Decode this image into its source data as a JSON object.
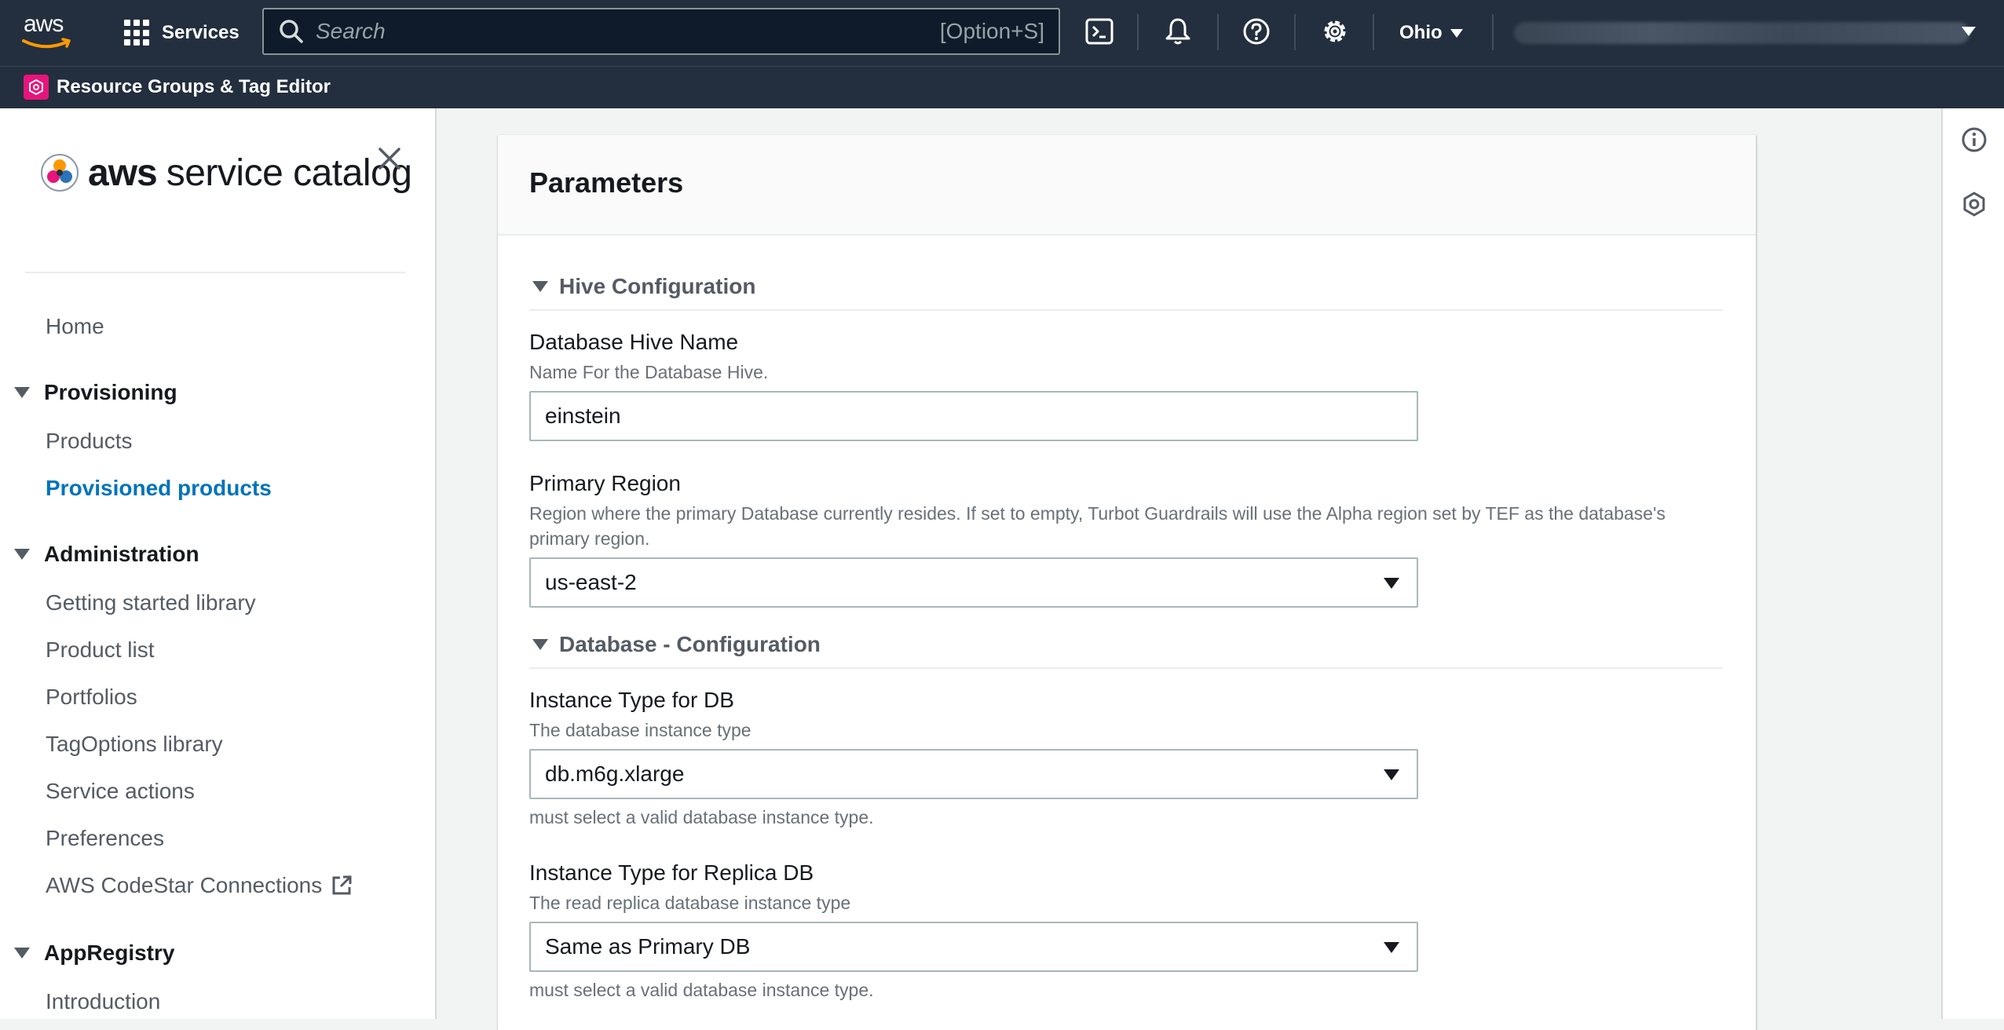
{
  "topnav": {
    "logo_text": "aws",
    "services_label": "Services",
    "search_placeholder": "Search",
    "search_shortcut": "[Option+S]",
    "region_label": "Ohio"
  },
  "subnav": {
    "resource_groups_label": "Resource Groups & Tag Editor"
  },
  "sidebar": {
    "brand_aws": "aws",
    "brand_name": "service catalog",
    "home": "Home",
    "sections": [
      {
        "title": "Provisioning",
        "items": [
          "Products",
          "Provisioned products"
        ]
      },
      {
        "title": "Administration",
        "items": [
          "Getting started library",
          "Product list",
          "Portfolios",
          "TagOptions library",
          "Service actions",
          "Preferences",
          "AWS CodeStar Connections"
        ]
      },
      {
        "title": "AppRegistry",
        "items": [
          "Introduction"
        ]
      }
    ],
    "active_item": "Provisioned products"
  },
  "panel": {
    "title": "Parameters",
    "groups": [
      {
        "label": "Hive Configuration"
      },
      {
        "label": "Database - Configuration"
      }
    ],
    "fields": [
      {
        "label": "Database Hive Name",
        "description": "Name For the Database Hive.",
        "value": "einstein",
        "type": "text"
      },
      {
        "label": "Primary Region",
        "description": "Region where the primary Database currently resides. If set to empty, Turbot Guardrails will use the Alpha region set by TEF as the database's primary region.",
        "value": "us-east-2",
        "type": "select"
      },
      {
        "label": "Instance Type for DB",
        "description": "The database instance type",
        "value": "db.m6g.xlarge",
        "type": "select",
        "constraint": "must select a valid database instance type."
      },
      {
        "label": "Instance Type for Replica DB",
        "description": "The read replica database instance type",
        "value": "Same as Primary DB",
        "type": "select",
        "constraint": "must select a valid database instance type."
      }
    ]
  },
  "icons": {
    "search": "search-icon",
    "cloudshell": "cloudshell-icon",
    "notifications": "bell-icon",
    "help": "help-icon",
    "settings": "gear-icon",
    "external": "external-link-icon",
    "info": "info-icon",
    "close": "close-icon"
  },
  "colors": {
    "nav_bg": "#232f3e",
    "link_active": "#0073bb",
    "resource_groups_accent": "#e7157b",
    "aws_smile": "#ff9900"
  }
}
